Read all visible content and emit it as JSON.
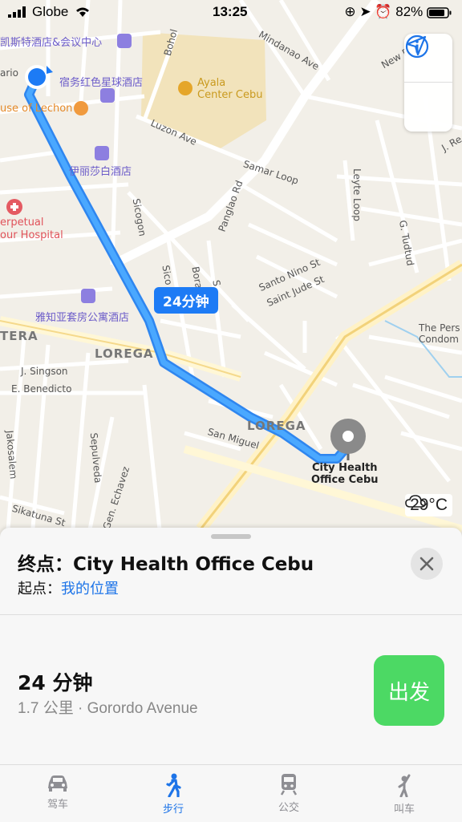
{
  "status_bar": {
    "carrier": "Globe",
    "time": "13:25",
    "battery": "82%"
  },
  "map": {
    "labels": {
      "hotel_top": "凯斯特酒店&会议中心",
      "hotel_red": "宿务红色星球酒店",
      "house_lechon": "use of Lechon",
      "ario": "ario",
      "ayala": "Ayala\nCenter Cebu",
      "elizabeth_hotel": "伊丽莎白酒店",
      "hospital": "erpetual\nour Hospital",
      "yazhiya": "雅知亚套房公寓酒店",
      "bohol": "Bohol",
      "mindanao": "Mindanao Ave",
      "new_f": "New F",
      "luzon": "Luzon Ave",
      "samar": "Samar Loop",
      "leyte": "Leyte Loop",
      "j_re": "J. Re",
      "sicogon": "Sicogon",
      "panglao": "Panglao Rd",
      "santo_nino": "Santo Nino St",
      "saint_jude": "Saint Jude St",
      "tudtud": "G. Tudtud",
      "the_pers": "The Pers\nCondom",
      "lorega1": "LOREGA",
      "lorega2": "LOREGA",
      "tera": "TERA",
      "singson": "J. Singson",
      "benedicto": "E. Benedicto",
      "san_miguel": "San Miguel",
      "jakosalem": "Jakosalem",
      "sepulveda": "Sepulveda",
      "echavez": "Gen. Echavez",
      "sikatuna": "Sikatuna St",
      "boraca": "Boraca",
      "sico": "Sico",
      "sv": "S",
      "destination": "City Health\nOffice Cebu"
    },
    "eta_bubble": "24分钟",
    "weather": "29°C",
    "buttons": {
      "info_icon": "info-icon",
      "locate_icon": "location-arrow-icon"
    }
  },
  "sheet": {
    "dest_prefix": "终点：",
    "dest_name": "City Health Office Cebu",
    "origin_prefix": "起点：",
    "origin_value": "我的位置",
    "route_time": "24 分钟",
    "route_detail": "1.7 公里 · Gorordo Avenue",
    "go_label": "出发"
  },
  "tabs": [
    {
      "label": "驾车",
      "icon": "car-icon",
      "active": false
    },
    {
      "label": "步行",
      "icon": "walk-icon",
      "active": true
    },
    {
      "label": "公交",
      "icon": "train-icon",
      "active": false
    },
    {
      "label": "叫车",
      "icon": "rideshare-icon",
      "active": false
    }
  ],
  "colors": {
    "route": "#3a9bff",
    "accent": "#1d74e8",
    "go_button": "#4cd964",
    "mall_area": "#f3e2b8"
  }
}
